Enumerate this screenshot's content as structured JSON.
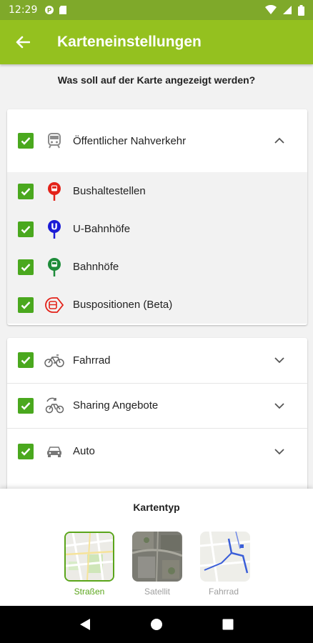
{
  "status": {
    "time": "12:29"
  },
  "appbar": {
    "title": "Karteneinstellungen"
  },
  "subtitle": "Was soll auf der Karte angezeigt werden?",
  "public_transport": {
    "label": "Öffentlicher Nahverkehr",
    "items": [
      {
        "label": "Bushaltestellen",
        "color": "#e32219"
      },
      {
        "label": "U-Bahnhöfe",
        "color": "#1b1bd6"
      },
      {
        "label": "Bahnhöfe",
        "color": "#1e8c3a"
      },
      {
        "label": "Buspositionen (Beta)",
        "color": "#e32219"
      }
    ]
  },
  "categories": [
    {
      "label": "Fahrrad",
      "icon": "bicycle-icon"
    },
    {
      "label": "Sharing Angebote",
      "icon": "sharing-icon"
    },
    {
      "label": "Auto",
      "icon": "car-icon"
    }
  ],
  "maptype": {
    "title": "Kartentyp",
    "options": [
      {
        "label": "Straßen",
        "selected": true
      },
      {
        "label": "Satellit",
        "selected": false
      },
      {
        "label": "Fahrrad",
        "selected": false
      }
    ]
  },
  "colors": {
    "accent": "#94c11f",
    "check": "#4aa81e",
    "selected": "#5aa51a"
  }
}
